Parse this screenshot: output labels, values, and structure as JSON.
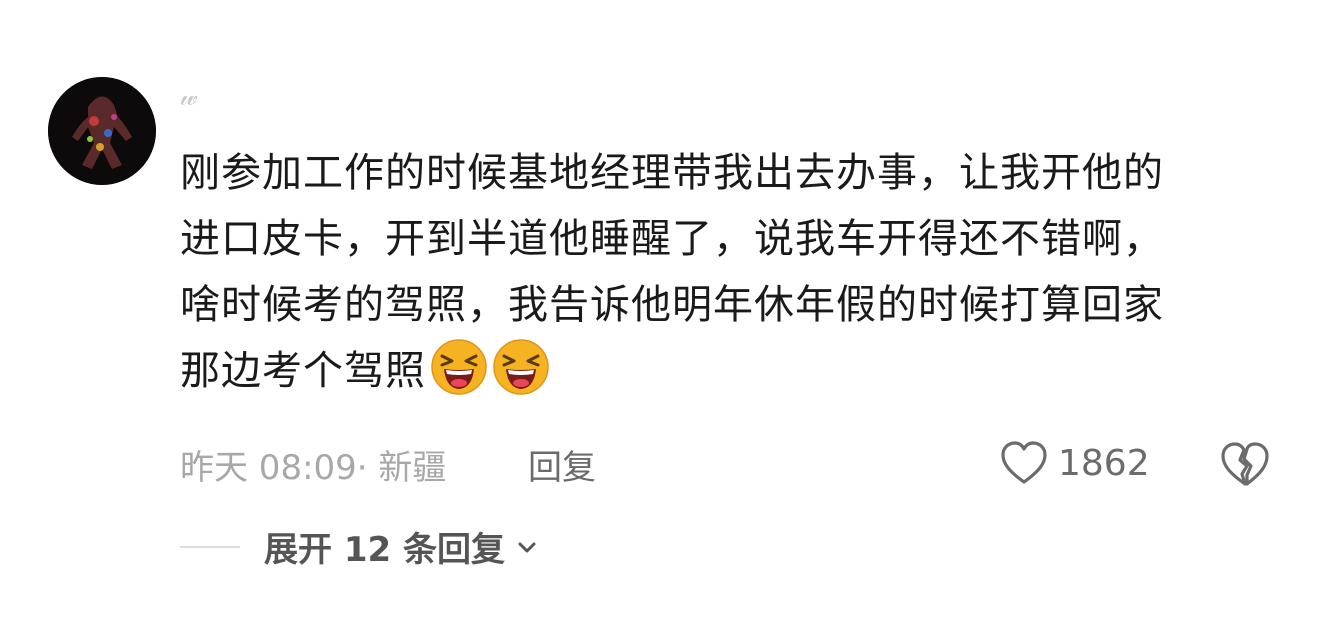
{
  "comment": {
    "username": "𝓌",
    "lines": [
      "刚参加工作的时候基地经理带我出去办事，让我开他的",
      "进口皮卡，开到半道他睡醒了，说我车开得还不错啊，",
      "啥时候考的驾照，我告诉他明年休年假的时候打算回家",
      "那边考个驾照"
    ],
    "emojis": [
      "laughing-face-icon",
      "laughing-face-icon"
    ],
    "meta": "昨天 08:09· 新疆",
    "reply_label": "回复",
    "like_count": "1862",
    "expand_label": "展开 12 条回复"
  },
  "colors": {
    "text": "#1a1a1a",
    "meta": "#a8a8a8",
    "action": "#6b6b6b",
    "emoji_face": "#f6b321"
  }
}
